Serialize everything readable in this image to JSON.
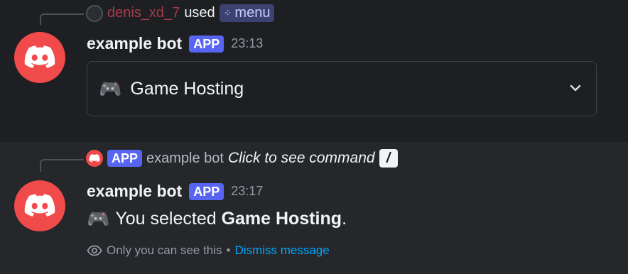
{
  "message1": {
    "reply": {
      "username": "denis_xd_7",
      "used_text": "used",
      "command_name": "menu"
    },
    "bot_name": "example bot",
    "badge": "APP",
    "timestamp": "23:13",
    "select_menu": {
      "icon": "🎮",
      "selected_label": "Game Hosting"
    }
  },
  "message2": {
    "reference": {
      "badge": "APP",
      "bot_name": "example bot",
      "click_text": "Click to see command",
      "slash": "/"
    },
    "bot_name": "example bot",
    "badge": "APP",
    "timestamp": "23:17",
    "content": {
      "icon": "🎮",
      "prefix": "You selected ",
      "bold": "Game Hosting",
      "suffix": "."
    },
    "ephemeral": {
      "notice": "Only you can see this",
      "separator": "•",
      "dismiss": "Dismiss message"
    }
  },
  "colors": {
    "background": "#1e1f22",
    "highlight_background": "#25272b",
    "accent": "#5865f2",
    "avatar": "#f04a4a",
    "link": "#00a8fc",
    "username": "#a83b4a"
  }
}
